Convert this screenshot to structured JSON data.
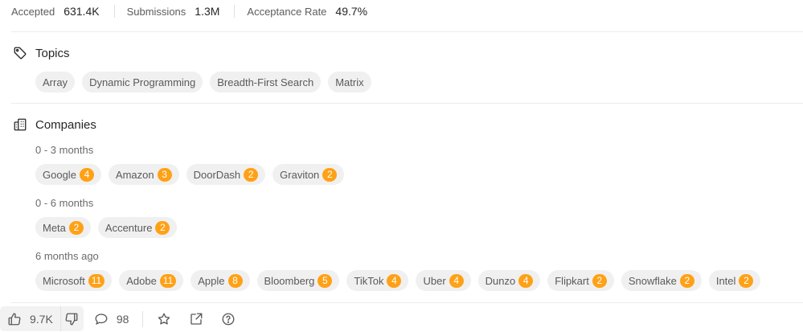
{
  "stats": {
    "accepted_label": "Accepted",
    "accepted_value": "631.4K",
    "submissions_label": "Submissions",
    "submissions_value": "1.3M",
    "acceptance_label": "Acceptance Rate",
    "acceptance_value": "49.7%"
  },
  "topics": {
    "title": "Topics",
    "icon": "tag-icon",
    "tags": [
      "Array",
      "Dynamic Programming",
      "Breadth-First Search",
      "Matrix"
    ]
  },
  "companies": {
    "title": "Companies",
    "icon": "building-icon",
    "groups": [
      {
        "period": "0 - 3 months",
        "items": [
          {
            "name": "Google",
            "count": "4"
          },
          {
            "name": "Amazon",
            "count": "3"
          },
          {
            "name": "DoorDash",
            "count": "2"
          },
          {
            "name": "Graviton",
            "count": "2"
          }
        ]
      },
      {
        "period": "0 - 6 months",
        "items": [
          {
            "name": "Meta",
            "count": "2"
          },
          {
            "name": "Accenture",
            "count": "2"
          }
        ]
      },
      {
        "period": "6 months ago",
        "items": [
          {
            "name": "Microsoft",
            "count": "11"
          },
          {
            "name": "Adobe",
            "count": "11"
          },
          {
            "name": "Apple",
            "count": "8"
          },
          {
            "name": "Bloomberg",
            "count": "5"
          },
          {
            "name": "TikTok",
            "count": "4"
          },
          {
            "name": "Uber",
            "count": "4"
          },
          {
            "name": "Dunzo",
            "count": "4"
          },
          {
            "name": "Flipkart",
            "count": "2"
          },
          {
            "name": "Snowflake",
            "count": "2"
          },
          {
            "name": "Intel",
            "count": "2"
          }
        ]
      }
    ]
  },
  "footer": {
    "likes": "9.7K",
    "comments": "98",
    "icons": [
      "thumbs-up-icon",
      "thumbs-down-icon",
      "comment-icon",
      "star-icon",
      "share-icon",
      "help-icon"
    ]
  },
  "colors": {
    "badge": "#ffa116",
    "chip_bg": "#f0f0f0"
  }
}
